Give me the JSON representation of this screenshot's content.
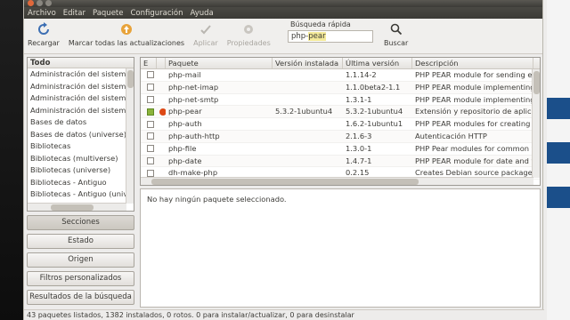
{
  "menu": [
    "Archivo",
    "Editar",
    "Paquete",
    "Configuración",
    "Ayuda"
  ],
  "toolbar": {
    "reload": "Recargar",
    "mark_all": "Marcar todas las actualizaciones",
    "apply": "Aplicar",
    "properties": "Propiedades",
    "search_label": "Búsqueda rápida",
    "search_value_prefix": "php-",
    "search_value_selected": "pear",
    "search_button": "Buscar"
  },
  "categories": {
    "header": "Todo",
    "items": [
      "Administración del sistema",
      "Administración del sistema",
      "Administración del sistema",
      "Administración del sistema",
      "Bases de datos",
      "Bases de datos (universe)",
      "Bibliotecas",
      "Bibliotecas (multiverse)",
      "Bibliotecas (universe)",
      "Bibliotecas - Antiguo",
      "Bibliotecas - Antiguo (unive"
    ]
  },
  "side_buttons": [
    "Secciones",
    "Estado",
    "Origen",
    "Filtros personalizados",
    "Resultados de la búsqueda"
  ],
  "packages": {
    "headers": [
      "E",
      "Paquete",
      "Versión instalada",
      "Última versión",
      "Descripción"
    ],
    "rows": [
      {
        "name": "php-mail",
        "installed": "",
        "latest": "1.1.14-2",
        "desc": "PHP PEAR module for sending em",
        "state": "none"
      },
      {
        "name": "php-net-imap",
        "installed": "",
        "latest": "1.1.0beta2-1.1",
        "desc": "PHP PEAR module implementing I",
        "state": "none"
      },
      {
        "name": "php-net-smtp",
        "installed": "",
        "latest": "1.3.1-1",
        "desc": "PHP PEAR module implementing S",
        "state": "none"
      },
      {
        "name": "php-pear",
        "installed": "5.3.2-1ubuntu4",
        "latest": "5.3.2-1ubuntu4",
        "desc": "Extensión y repositorio de aplicac",
        "state": "installed"
      },
      {
        "name": "php-auth",
        "installed": "",
        "latest": "1.6.2-1ubuntu1",
        "desc": "PHP PEAR modules for creating ar",
        "state": "none"
      },
      {
        "name": "php-auth-http",
        "installed": "",
        "latest": "2.1.6-3",
        "desc": "Autenticación HTTP",
        "state": "none"
      },
      {
        "name": "php-file",
        "installed": "",
        "latest": "1.3.0-1",
        "desc": "PHP Pear modules for common file",
        "state": "none"
      },
      {
        "name": "php-date",
        "installed": "",
        "latest": "1.4.7-1",
        "desc": "PHP PEAR module for date and tin",
        "state": "none"
      },
      {
        "name": "dh-make-php",
        "installed": "",
        "latest": "0.2.15",
        "desc": "Creates Debian source packages f",
        "state": "none"
      }
    ]
  },
  "detail_text": "No hay ningún paquete seleccionado.",
  "status": "43 paquetes listados, 1382 instalados, 0 rotos. 0 para instalar/actualizar, 0 para desinstalar"
}
